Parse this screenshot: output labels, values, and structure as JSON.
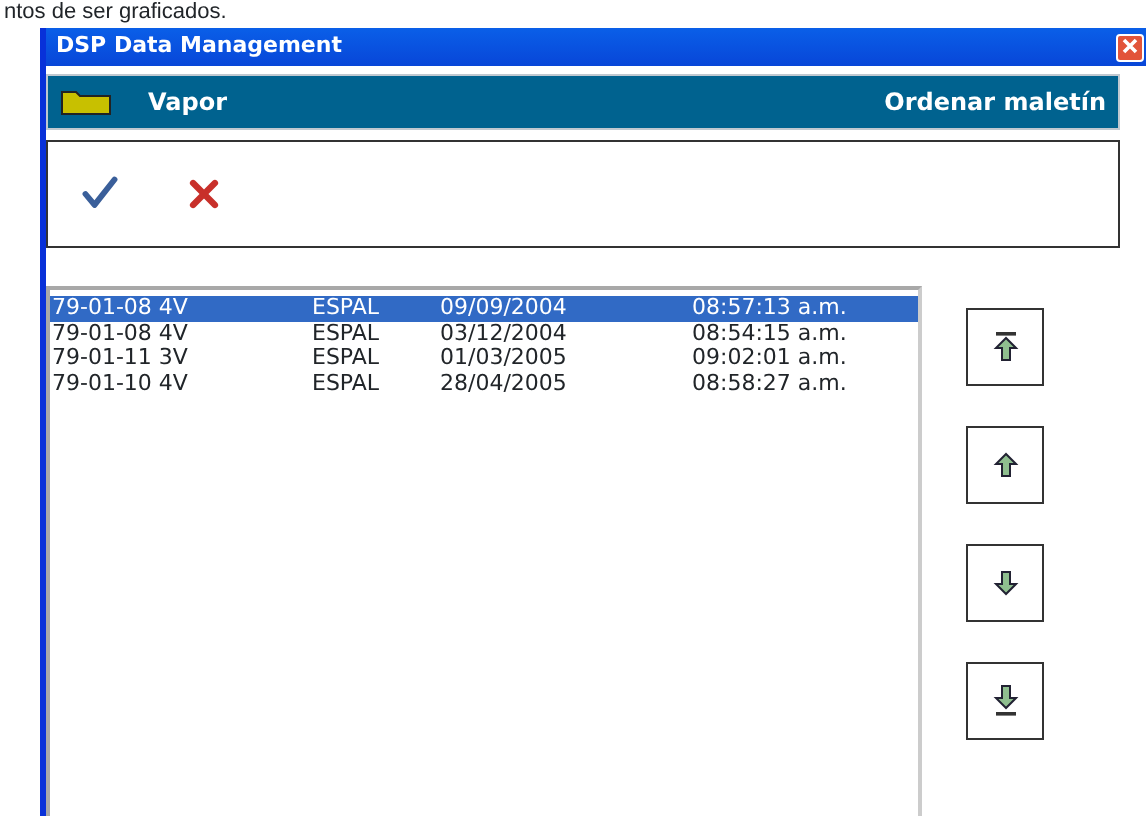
{
  "caption": "ntos de ser graficados.",
  "window": {
    "title": "DSP Data Management"
  },
  "header": {
    "folder": "Vapor",
    "action": "Ordenar maletín"
  },
  "toolbar": [
    {
      "kind": "accept"
    },
    {
      "kind": "cancel"
    }
  ],
  "list": {
    "rows": [
      {
        "cells": [
          "79-01-08 4V",
          "ESPAL",
          "09/09/2004",
          "08:57:13 a.m."
        ],
        "selected": true
      },
      {
        "cells": [
          "79-01-08 4V",
          "ESPAL",
          "03/12/2004",
          "08:54:15 a.m."
        ],
        "selected": false
      },
      {
        "cells": [
          "79-01-11 3V",
          "ESPAL",
          "01/03/2005",
          "09:02:01 a.m."
        ],
        "selected": false
      },
      {
        "cells": [
          "79-01-10 4V",
          "ESPAL",
          "28/04/2005",
          "08:58:27 a.m."
        ],
        "selected": false
      }
    ]
  },
  "move_buttons": [
    {
      "kind": "top"
    },
    {
      "kind": "up"
    },
    {
      "kind": "down"
    },
    {
      "kind": "bottom"
    }
  ]
}
